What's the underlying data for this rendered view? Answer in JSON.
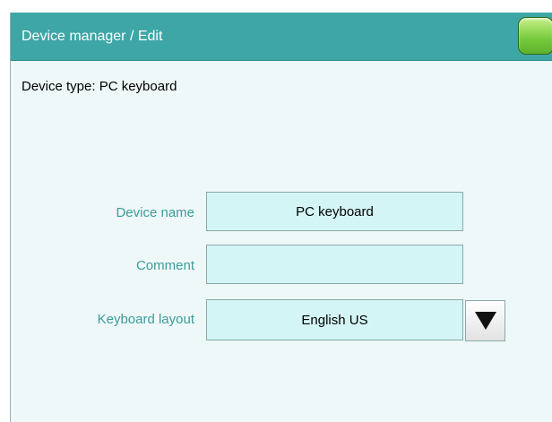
{
  "titlebar": {
    "title": "Device manager / Edit",
    "home_button_color": "#74c93a",
    "background_color": "#3fa6a6"
  },
  "device_type": "Device type: PC keyboard",
  "form": {
    "device_name": {
      "label": "Device name",
      "value": "PC keyboard"
    },
    "comment": {
      "label": "Comment",
      "value": ""
    },
    "keyboard_layout": {
      "label": "Keyboard layout",
      "value": "English US",
      "dropdown_icon": "triangle-down-icon"
    }
  },
  "colors": {
    "label": "#3c9c9c",
    "field_background": "#d4f5f5",
    "screen_background": "#eef8f8"
  }
}
